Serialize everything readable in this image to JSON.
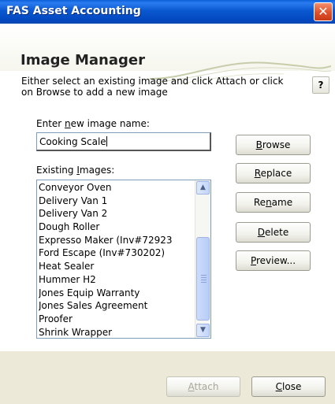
{
  "window": {
    "title": "FAS Asset Accounting",
    "close_glyph": "✕"
  },
  "header": {
    "title": "Image Manager"
  },
  "instructions": "Either select an existing image and click Attach or click on Browse to add a new image",
  "help_label": "?",
  "name_field": {
    "label_pre": "Enter ",
    "label_mnemonic": "n",
    "label_post": "ew image name:",
    "value": "Cooking Scale"
  },
  "existing": {
    "label_pre": "Existing ",
    "label_mnemonic": "I",
    "label_post": "mages:",
    "items": [
      "Conveyor Oven",
      "Delivery Van 1",
      "Delivery Van 2",
      "Dough Roller",
      "Expresso Maker (Inv#72923",
      "Ford Escape (Inv#730202)",
      "Heat Sealer",
      "Hummer H2",
      "Jones Equip Warranty",
      "Jones Sales Agreement",
      "Proofer",
      "Shrink Wrapper"
    ]
  },
  "buttons": {
    "browse": {
      "mnemonic": "B",
      "rest": "rowse"
    },
    "replace": {
      "mnemonic": "R",
      "rest": "eplace"
    },
    "rename": {
      "pre": "Re",
      "mnemonic": "n",
      "rest": "ame"
    },
    "delete": {
      "mnemonic": "D",
      "rest": "elete"
    },
    "preview": {
      "mnemonic": "P",
      "rest": "review..."
    },
    "attach": {
      "mnemonic": "A",
      "rest": "ttach",
      "enabled": false
    },
    "close": {
      "mnemonic": "C",
      "rest": "lose"
    }
  },
  "icons": {
    "close": "close-icon",
    "scroll_up": "arrow-up-icon",
    "scroll_down": "arrow-down-icon"
  },
  "colors": {
    "titlebar": "#0a58d0",
    "close": "#e0502a",
    "footer": "#ece9d8"
  }
}
